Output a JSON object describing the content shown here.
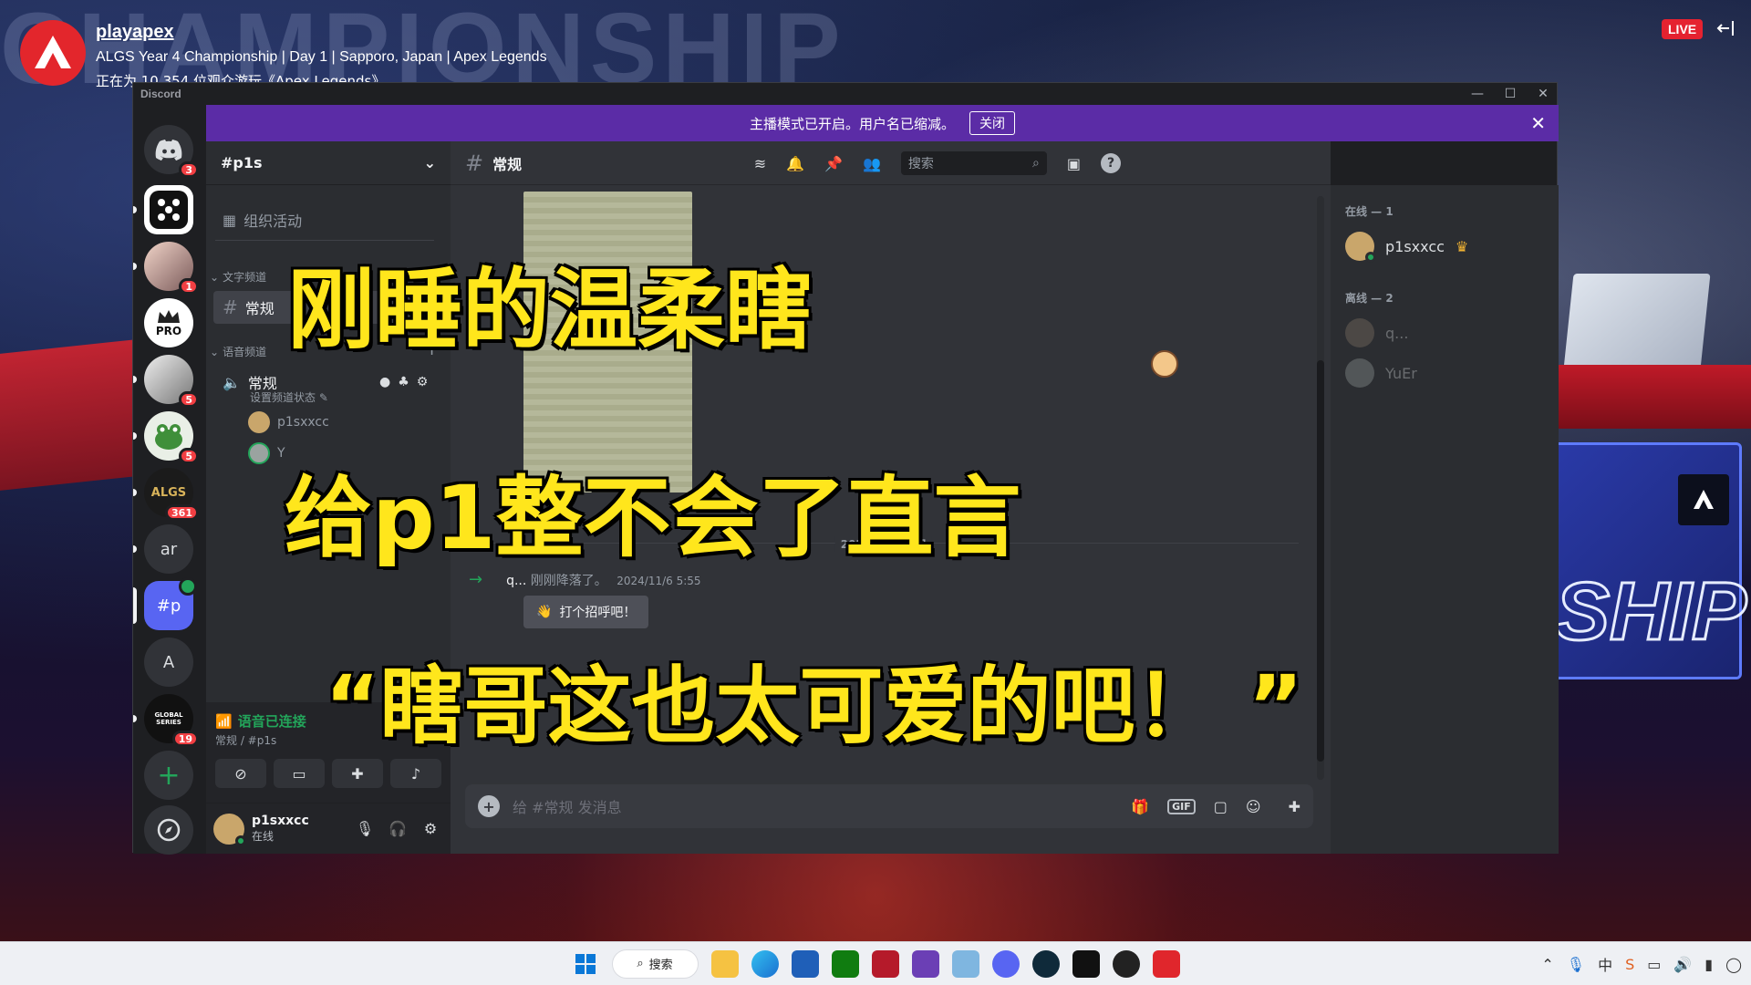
{
  "stream": {
    "channel": "playapex",
    "title": "ALGS Year 4 Championship | Day 1 | Sapporo, Japan | Apex Legends",
    "viewers": "正在为 10,354 位观众游玩《Apex Legends》",
    "live_label": "LIVE",
    "bg_text": "CHAMPIONSHIP"
  },
  "window": {
    "app_title": "Discord"
  },
  "banner": {
    "text": "主播模式已开启。用户名已缩减。",
    "button": "关闭"
  },
  "servers": [
    {
      "label": "",
      "icon": "discord-home-icon",
      "badge": "3"
    },
    {
      "label": "",
      "icon": "dice-server-icon",
      "badge": ""
    },
    {
      "label": "",
      "icon": "avatar-server-icon",
      "badge": "1"
    },
    {
      "label": "PRO",
      "icon": "crown-server-icon",
      "badge": ""
    },
    {
      "label": "",
      "icon": "anime-server-icon",
      "badge": "5"
    },
    {
      "label": "",
      "icon": "frog-server-icon",
      "badge": "5"
    },
    {
      "label": "ALGS",
      "icon": "algs-server-icon",
      "badge": "361"
    },
    {
      "label": "ar",
      "icon": "",
      "badge": ""
    },
    {
      "label": "#p",
      "icon": "",
      "badge": ""
    },
    {
      "label": "A",
      "icon": "",
      "badge": ""
    },
    {
      "label": "GLOBAL SERIES",
      "icon": "apex-global-server-icon",
      "badge": "19"
    }
  ],
  "sidebar": {
    "guild_name": "#p1s",
    "events": "组织活动",
    "text_category": "文字频道",
    "text_channel": "常规",
    "voice_category": "语音频道",
    "voice_channel": "常规",
    "voice_status": "设置频道状态",
    "voice_users": [
      "p1sxxcc",
      "Y"
    ]
  },
  "voice": {
    "status": "语音已连接",
    "location": "常规 / #p1s"
  },
  "user": {
    "name": "p1sxxcc",
    "status": "在线"
  },
  "chat": {
    "channel": "常规",
    "search_placeholder": "搜索",
    "date_divider": "2024年11月6日",
    "system_msg_user": "q...",
    "system_msg_text": "刚刚降落了。",
    "system_msg_time": "2024/11/6 5:55",
    "wave_button": "打个招呼吧！",
    "composer_placeholder": "给 #常规 发消息"
  },
  "members": {
    "online_header": "在线 — 1",
    "online": [
      "p1sxxcc"
    ],
    "offline_header": "离线 — 2",
    "offline": [
      "q...",
      "YuEr"
    ]
  },
  "captions": {
    "line1": "刚睡的温柔瞎",
    "line2": "给p1整不会了直言",
    "line3": "“瞎哥这也太可爱的吧！ ”"
  },
  "taskbar": {
    "search_label": "搜索"
  },
  "colors": {
    "banner": "#5b2ca6",
    "caption_fill": "#ffe61c",
    "online_green": "#23a55a",
    "mention_red": "#f23f43",
    "live_red": "#e52230"
  }
}
